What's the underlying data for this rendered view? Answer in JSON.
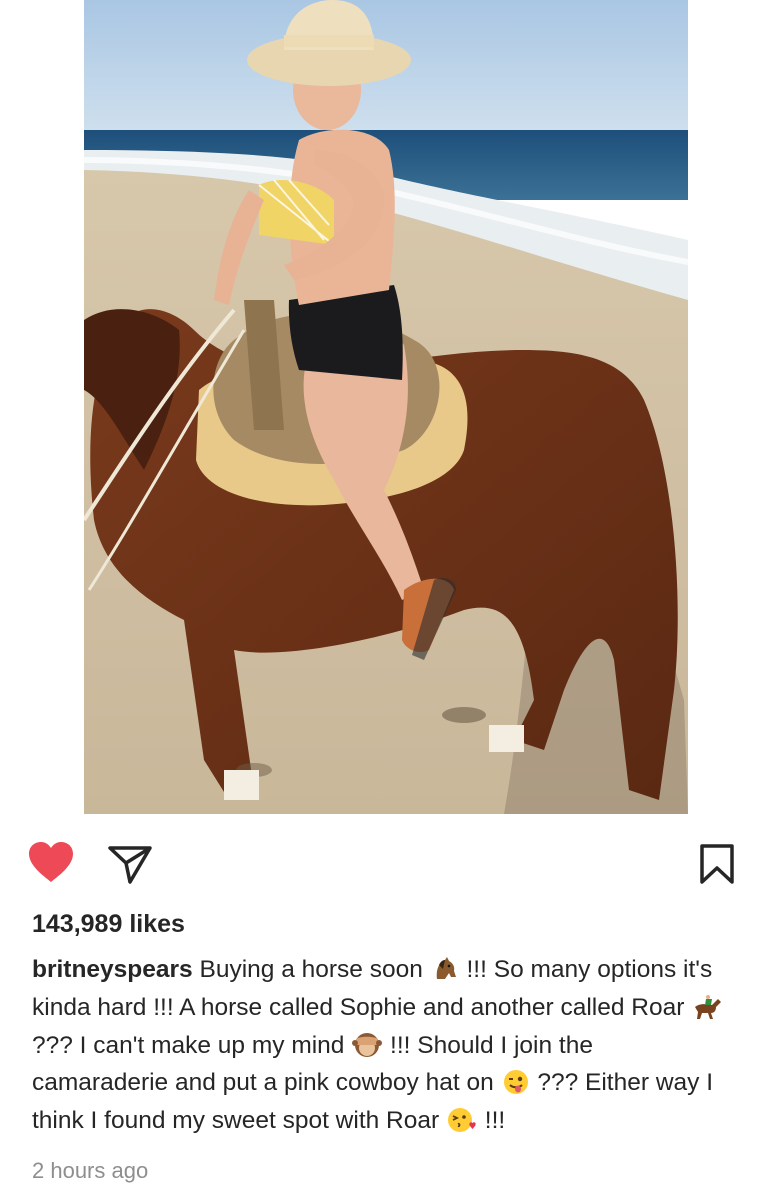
{
  "post": {
    "image_alt": "Woman in a wide-brim hat and yellow bikini top riding a brown horse on a beach",
    "likes": "143,989 likes",
    "caption": {
      "username": "britneyspears",
      "segments": [
        {
          "type": "text",
          "value": " Buying a horse soon "
        },
        {
          "type": "emoji",
          "icon": "horse-face-emoji"
        },
        {
          "type": "text",
          "value": " !!! So many options it's kinda hard !!! A horse called Sophie and another called Roar "
        },
        {
          "type": "emoji",
          "icon": "racing-horse-emoji"
        },
        {
          "type": "text",
          "value": " ??? I can't make up my mind "
        },
        {
          "type": "emoji",
          "icon": "see-no-evil-monkey-emoji"
        },
        {
          "type": "text",
          "value": " !!! Should I join the camaraderie and put a pink cowboy hat on "
        },
        {
          "type": "emoji",
          "icon": "winking-tongue-emoji"
        },
        {
          "type": "text",
          "value": " ??? Either way I think I found my sweet spot with Roar "
        },
        {
          "type": "emoji",
          "icon": "kissing-heart-emoji"
        },
        {
          "type": "text",
          "value": " !!!"
        }
      ]
    },
    "timestamp": "2 hours ago"
  },
  "actions": {
    "like_icon": "heart-icon",
    "share_icon": "paper-plane-icon",
    "save_icon": "bookmark-icon",
    "liked": true
  },
  "colors": {
    "like_red": "#ed4956",
    "text": "#262626",
    "muted": "#8e8e8e"
  }
}
